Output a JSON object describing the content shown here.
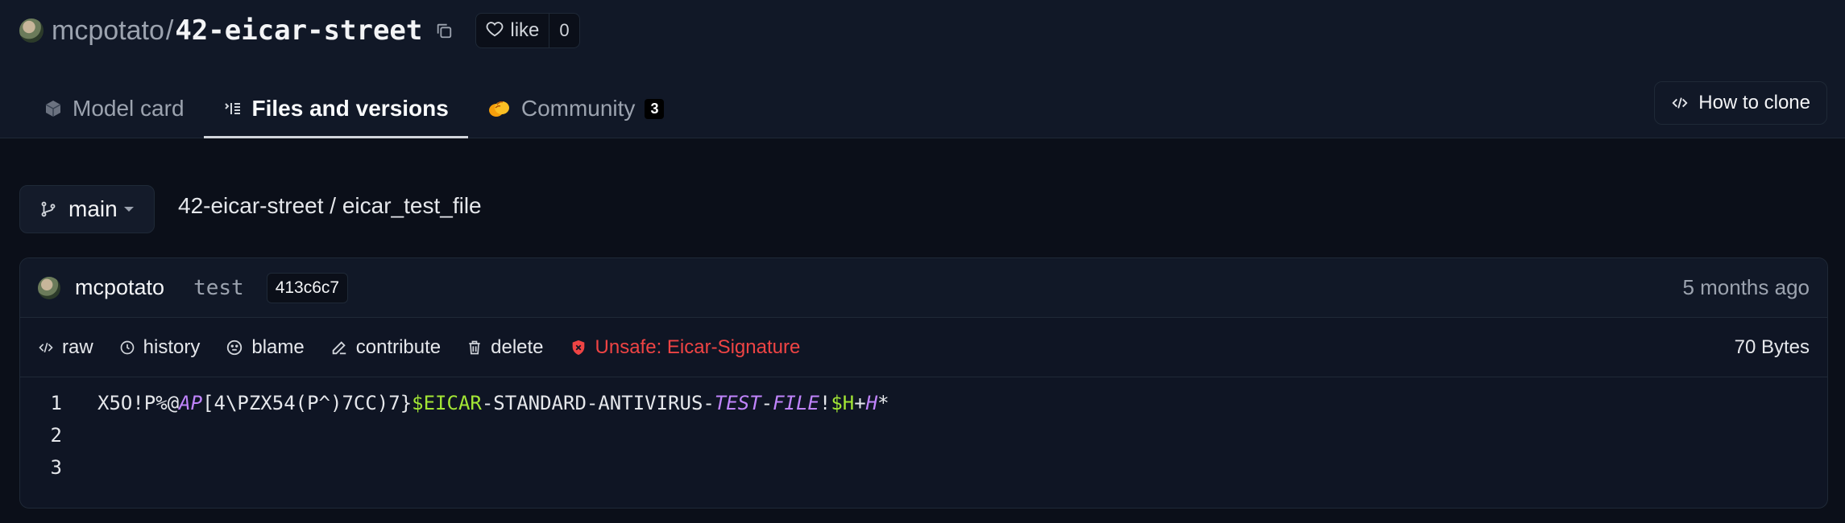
{
  "repo": {
    "owner": "mcpotato",
    "separator": "/",
    "name": "42-eicar-street",
    "like_label": "like",
    "like_count": "0"
  },
  "tabs": [
    {
      "label": "Model card",
      "icon": "cube-icon"
    },
    {
      "label": "Files and versions",
      "icon": "files-icon",
      "active": true
    },
    {
      "label": "Community",
      "icon": "hands-icon",
      "badge": "3"
    }
  ],
  "clone_button": {
    "label": "How to clone",
    "icon": "code-icon"
  },
  "branch": {
    "label": "main",
    "icon": "branch-icon"
  },
  "breadcrumb": "42-eicar-street / eicar_test_file",
  "commit": {
    "author": "mcpotato",
    "message": "test",
    "hash": "413c6c7",
    "time": "5 months ago"
  },
  "actions": {
    "raw": "raw",
    "history": "history",
    "blame": "blame",
    "contribute": "contribute",
    "delete": "delete",
    "unsafe": "Unsafe: Eicar-Signature",
    "size": "70 Bytes"
  },
  "code": {
    "line_numbers": [
      "1",
      "2",
      "3"
    ],
    "line1_segments": [
      {
        "text": "X5O!P%@",
        "style": "plain"
      },
      {
        "text": "AP",
        "style": "purple"
      },
      {
        "text": "[4\\PZX54(P^)7CC)7}",
        "style": "plain"
      },
      {
        "text": "$EICAR",
        "style": "green"
      },
      {
        "text": "-STANDARD-ANTIVIRUS-",
        "style": "plain"
      },
      {
        "text": "TEST",
        "style": "purple"
      },
      {
        "text": "-",
        "style": "plain"
      },
      {
        "text": "FILE",
        "style": "purple"
      },
      {
        "text": "!",
        "style": "plain"
      },
      {
        "text": "$H",
        "style": "green"
      },
      {
        "text": "+",
        "style": "plain"
      },
      {
        "text": "H",
        "style": "purple"
      },
      {
        "text": "*",
        "style": "plain"
      }
    ]
  },
  "colors": {
    "background": "#0b0f19",
    "unsafe": "#ef4444",
    "syntax_purple": "#c084fc",
    "syntax_green": "#a3e635"
  }
}
